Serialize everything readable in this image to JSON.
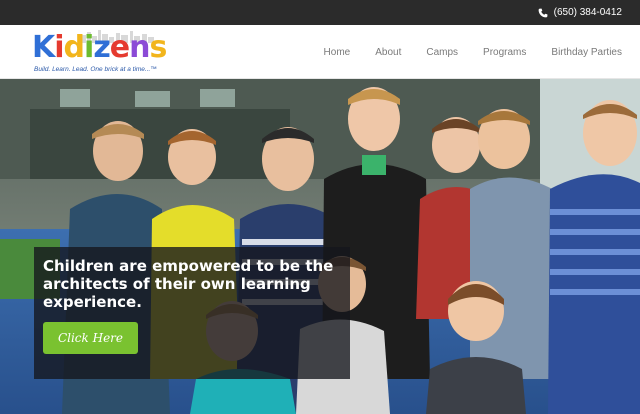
{
  "topbar": {
    "phone": "(650) 384-0412",
    "icon": "phone-icon"
  },
  "brand": {
    "logo_letters": [
      {
        "ch": "K",
        "color": "#2f6fd6"
      },
      {
        "ch": "i",
        "color": "#e53a2f"
      },
      {
        "ch": "d",
        "color": "#f2b51c"
      },
      {
        "ch": "i",
        "color": "#6dbb2f"
      },
      {
        "ch": "z",
        "color": "#2f6fd6"
      },
      {
        "ch": "e",
        "color": "#e53a2f"
      },
      {
        "ch": "n",
        "color": "#8b4ad6"
      },
      {
        "ch": "s",
        "color": "#f2b51c"
      }
    ],
    "tagline": "Build. Learn. Lead. One brick at a time...™"
  },
  "nav": {
    "items": [
      {
        "label": "Home"
      },
      {
        "label": "About"
      },
      {
        "label": "Camps"
      },
      {
        "label": "Programs"
      },
      {
        "label": "Birthday Parties"
      }
    ]
  },
  "hero": {
    "headline": "Children are empowered to be the architects of their own learning experience.",
    "cta_label": "Click Here"
  },
  "colors": {
    "topbar": "#2b2b2b",
    "cta": "#7ac230",
    "nav_text": "#7a7a7a"
  }
}
